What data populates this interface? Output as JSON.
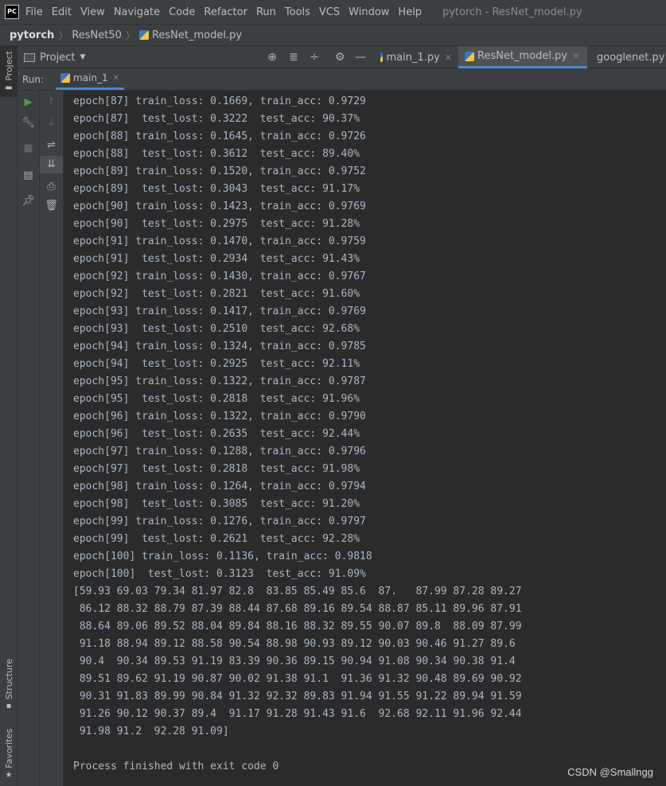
{
  "menubar": {
    "logo_text": "PC",
    "items": [
      "File",
      "Edit",
      "View",
      "Navigate",
      "Code",
      "Refactor",
      "Run",
      "Tools",
      "VCS",
      "Window",
      "Help"
    ],
    "title": "pytorch - ResNet_model.py"
  },
  "breadcrumb": {
    "root": "pytorch",
    "folder": "ResNet50",
    "file": "ResNet_model.py"
  },
  "sidebar": {
    "project_tab": "Project",
    "structure_tab": "Structure",
    "favorites_tab": "Favorites"
  },
  "tool_window": {
    "selector_label": "Project",
    "icons": [
      "locate-icon",
      "expand-all-icon",
      "collapse-all-icon",
      "settings-icon",
      "hide-icon"
    ]
  },
  "editor_tabs": [
    {
      "label": "main_1.py",
      "active": false
    },
    {
      "label": "ResNet_model.py",
      "active": true
    },
    {
      "label": "googlenet.py",
      "active": false
    }
  ],
  "run": {
    "label": "Run:",
    "tab": "main_1"
  },
  "console": {
    "lines": [
      "epoch[87] train_loss: 0.1669, train_acc: 0.9729",
      "epoch[87]  test_lost: 0.3222  test_acc: 90.37%",
      "epoch[88] train_loss: 0.1645, train_acc: 0.9726",
      "epoch[88]  test_lost: 0.3612  test_acc: 89.40%",
      "epoch[89] train_loss: 0.1520, train_acc: 0.9752",
      "epoch[89]  test_lost: 0.3043  test_acc: 91.17%",
      "epoch[90] train_loss: 0.1423, train_acc: 0.9769",
      "epoch[90]  test_lost: 0.2975  test_acc: 91.28%",
      "epoch[91] train_loss: 0.1470, train_acc: 0.9759",
      "epoch[91]  test_lost: 0.2934  test_acc: 91.43%",
      "epoch[92] train_loss: 0.1430, train_acc: 0.9767",
      "epoch[92]  test_lost: 0.2821  test_acc: 91.60%",
      "epoch[93] train_loss: 0.1417, train_acc: 0.9769",
      "epoch[93]  test_lost: 0.2510  test_acc: 92.68%",
      "epoch[94] train_loss: 0.1324, train_acc: 0.9785",
      "epoch[94]  test_lost: 0.2925  test_acc: 92.11%",
      "epoch[95] train_loss: 0.1322, train_acc: 0.9787",
      "epoch[95]  test_lost: 0.2818  test_acc: 91.96%",
      "epoch[96] train_loss: 0.1322, train_acc: 0.9790",
      "epoch[96]  test_lost: 0.2635  test_acc: 92.44%",
      "epoch[97] train_loss: 0.1288, train_acc: 0.9796",
      "epoch[97]  test_lost: 0.2818  test_acc: 91.98%",
      "epoch[98] train_loss: 0.1264, train_acc: 0.9794",
      "epoch[98]  test_lost: 0.3085  test_acc: 91.20%",
      "epoch[99] train_loss: 0.1276, train_acc: 0.9797",
      "epoch[99]  test_lost: 0.2621  test_acc: 92.28%",
      "epoch[100] train_loss: 0.1136, train_acc: 0.9818",
      "epoch[100]  test_lost: 0.3123  test_acc: 91.09%",
      "[59.93 69.03 79.34 81.97 82.8  83.85 85.49 85.6  87.   87.99 87.28 89.27",
      " 86.12 88.32 88.79 87.39 88.44 87.68 89.16 89.54 88.87 85.11 89.96 87.91",
      " 88.64 89.06 89.52 88.04 89.84 88.16 88.32 89.55 90.07 89.8  88.09 87.99",
      " 91.18 88.94 89.12 88.58 90.54 88.98 90.93 89.12 90.03 90.46 91.27 89.6",
      " 90.4  90.34 89.53 91.19 83.39 90.36 89.15 90.94 91.08 90.34 90.38 91.4",
      " 89.51 89.62 91.19 90.87 90.02 91.38 91.1  91.36 91.32 90.48 89.69 90.92",
      " 90.31 91.83 89.99 90.84 91.32 92.32 89.83 91.94 91.55 91.22 89.94 91.59",
      " 91.26 90.12 90.37 89.4  91.17 91.28 91.43 91.6  92.68 92.11 91.96 92.44",
      " 91.98 91.2  92.28 91.09]",
      "",
      "Process finished with exit code 0"
    ]
  },
  "watermark": "CSDN @Smallngg",
  "colors": {
    "accent": "#4a88c7",
    "run_green": "#499c54",
    "console_bg": "#2b2b2b",
    "panel_bg": "#3c3f41"
  }
}
